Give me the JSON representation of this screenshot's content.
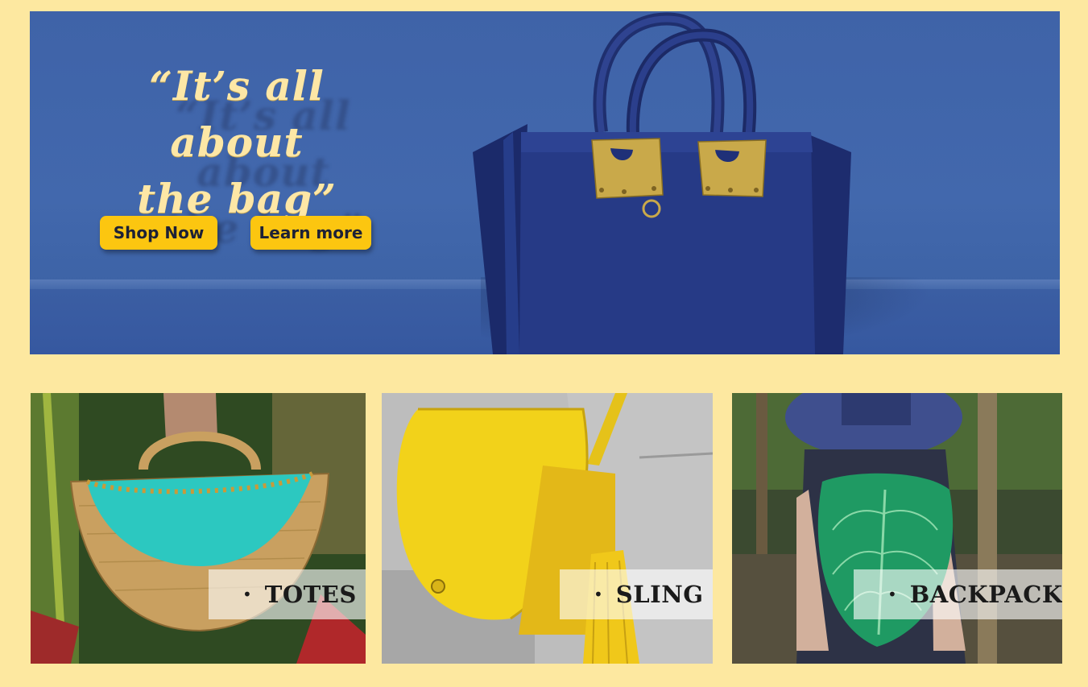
{
  "hero": {
    "tagline": "“It’s all about\nthe bag”",
    "shop_now_label": "Shop Now",
    "learn_more_label": "Learn more"
  },
  "categories": [
    {
      "label": "TOTES",
      "bullet": "•"
    },
    {
      "label": "SLING",
      "bullet": "•"
    },
    {
      "label": "BACKPACK",
      "bullet": "•"
    }
  ],
  "colors": {
    "page_background": "#fde8a0",
    "hero_blue": "#4268ad",
    "button_yellow": "#fcc610",
    "tagline_cream": "#fde7a6"
  }
}
